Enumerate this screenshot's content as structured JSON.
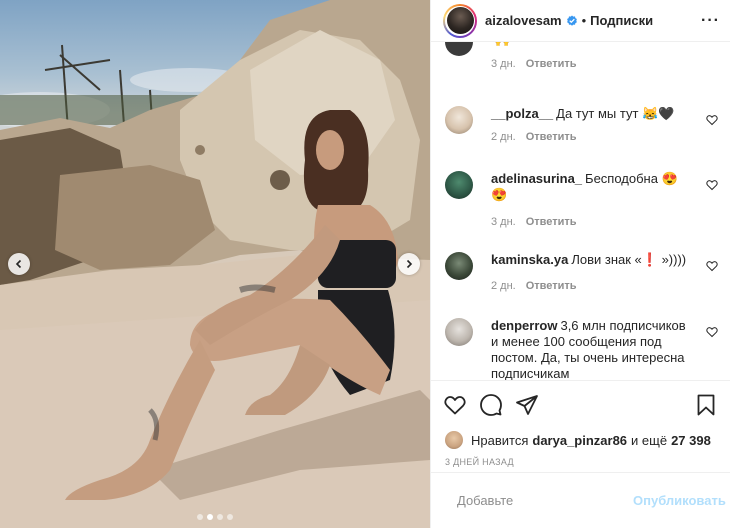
{
  "header": {
    "username": "aizalovesam",
    "separator": "•",
    "follow_label": "Подписки",
    "more_label": "···"
  },
  "comments": [
    {
      "name": "",
      "text": "🙌",
      "time": "3 дн.",
      "reply": "Ответить",
      "has_like": false
    },
    {
      "name": "__polza__",
      "text": "Да тут мы тут 😹🖤",
      "time": "2 дн.",
      "reply": "Ответить",
      "has_like": true
    },
    {
      "name": "adelinasurina_",
      "text": "Бесподобна 😍 😍",
      "time": "3 дн.",
      "reply": "Ответить",
      "has_like": true
    },
    {
      "name": "kaminska.ya",
      "text": "Лови знак «❗ »))))",
      "time": "2 дн.",
      "reply": "Ответить",
      "has_like": true
    },
    {
      "name": "denperrow",
      "text": "3,6 млн подписчиков и менее 100 сообщения под постом. Да, ты очень интересна подписчикам",
      "time": "",
      "reply": "",
      "has_like": true
    }
  ],
  "likes": {
    "prefix": "Нравится",
    "user": "darya_pinzar86",
    "middle": "и ещё",
    "count": "27 398"
  },
  "date": "3 ДНЕЙ НАЗАД",
  "composer": {
    "placeholder": "Добавьте",
    "publish_label": "Опубликовать"
  },
  "carousel": {
    "slide_count": 4,
    "active_index": 1
  },
  "colors": {
    "verified": "#3897f0",
    "publish_disabled": "#b2dffc",
    "meta": "#8e8e8e",
    "text": "#262626"
  }
}
